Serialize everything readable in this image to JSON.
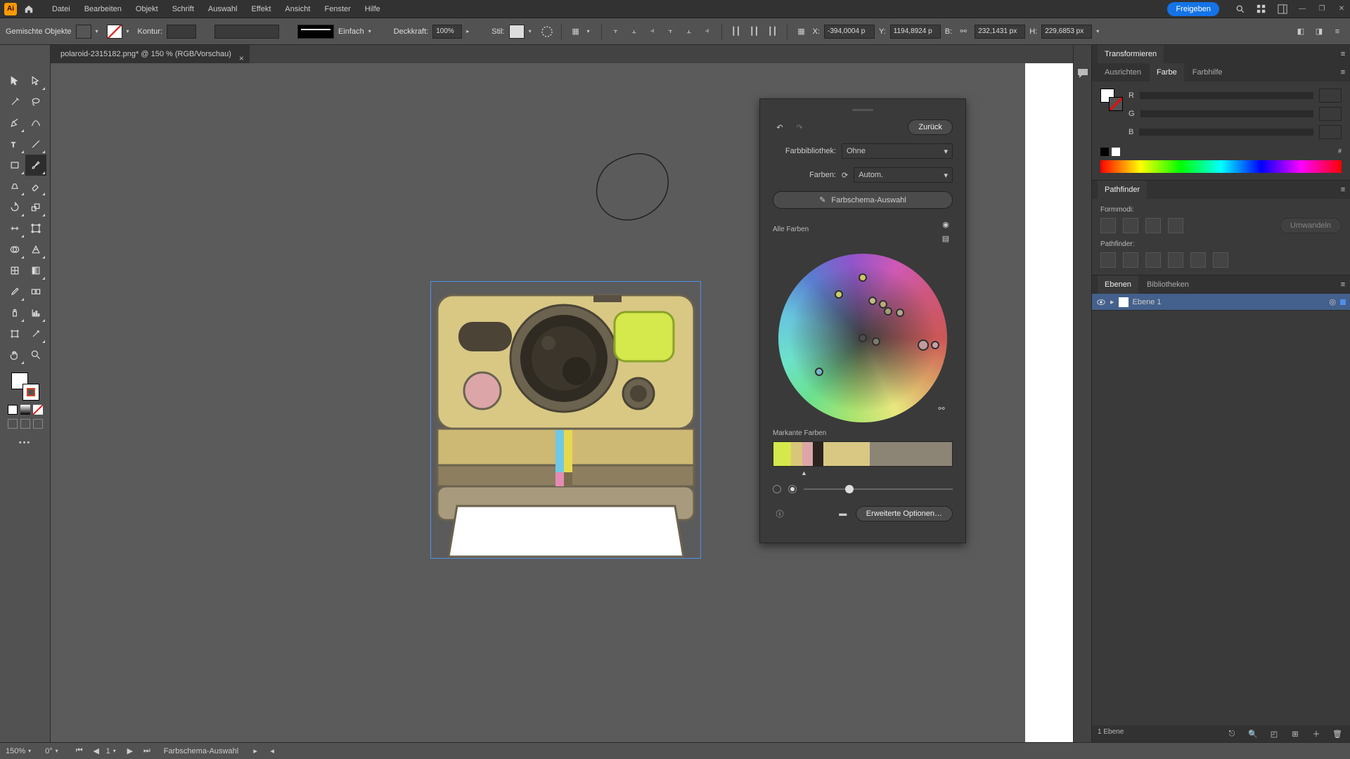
{
  "app": {
    "logo_text": "Ai"
  },
  "menu": [
    "Datei",
    "Bearbeiten",
    "Objekt",
    "Schrift",
    "Auswahl",
    "Effekt",
    "Ansicht",
    "Fenster",
    "Hilfe"
  ],
  "share_label": "Freigeben",
  "ctrl": {
    "mixed": "Gemischte Objekte",
    "stroke_lbl": "Kontur:",
    "stroke_style": "Einfach",
    "opacity_lbl": "Deckkraft:",
    "opacity_val": "100%",
    "style_lbl": "Stil:",
    "x_lbl": "X:",
    "x_val": "-394,0004 p",
    "y_lbl": "Y:",
    "y_val": "1194,8924 p",
    "w_lbl": "B:",
    "w_val": "232,1431 px",
    "h_lbl": "H:",
    "h_val": "229,6853 px"
  },
  "tab": {
    "title": "polaroid-2315182.png* @ 150 % (RGB/Vorschau)"
  },
  "recolor": {
    "back": "Zurück",
    "lib_lbl": "Farbbibliothek:",
    "lib_val": "Ohne",
    "colors_lbl": "Farben:",
    "colors_val": "Autom.",
    "theme_btn": "Farbschema-Auswahl",
    "all_colors": "Alle Farben",
    "prominent": "Markante Farben",
    "adv": "Erweiterte Optionen…",
    "prom_colors": [
      {
        "c": "#d5e84c",
        "w": 10
      },
      {
        "c": "#d8c67a",
        "w": 6
      },
      {
        "c": "#dca6a8",
        "w": 6
      },
      {
        "c": "#2b241f",
        "w": 6
      },
      {
        "c": "#d8c884",
        "w": 26
      },
      {
        "c": "#8c8576",
        "w": 46
      }
    ]
  },
  "panels": {
    "transform": "Transformieren",
    "color_tabs": [
      "Ausrichten",
      "Farbe",
      "Farbhilfe"
    ],
    "color_active": 1,
    "rgb": {
      "r": "R",
      "g": "G",
      "b": "B"
    },
    "pathfinder": "Pathfinder",
    "pf_shape": "Formmodi:",
    "pf_pf": "Pathfinder:",
    "layer_tabs": [
      "Ebenen",
      "Bibliotheken"
    ],
    "layer_active": 0,
    "layer_name": "Ebene 1",
    "layer_count": "1 Ebene"
  },
  "status": {
    "zoom": "150%",
    "angle": "0°",
    "artboard": "1",
    "tool": "Farbschema-Auswahl"
  },
  "chart_data": {
    "type": "table",
    "note": "Prominent color weights shown in recolor panel",
    "colors": [
      "#d5e84c",
      "#d8c67a",
      "#dca6a8",
      "#2b241f",
      "#d8c884",
      "#8c8576"
    ],
    "weights_pct": [
      10,
      6,
      6,
      6,
      26,
      46
    ]
  }
}
